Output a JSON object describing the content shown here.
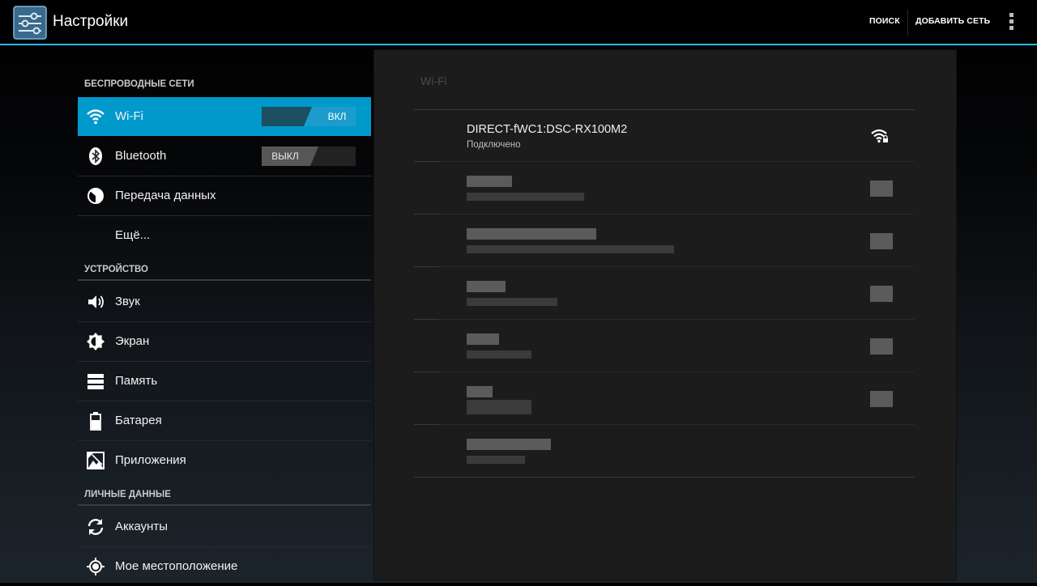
{
  "app": {
    "title": "Настройки",
    "icon": "settings-sliders-icon"
  },
  "actionbar": {
    "search_label": "ПОИСК",
    "add_network_label": "ДОБАВИТЬ СЕТЬ",
    "overflow_icon": "overflow-menu-icon"
  },
  "sections": {
    "wireless": "БЕСПРОВОДНЫЕ СЕТИ",
    "device": "УСТРОЙСТВО",
    "personal": "ЛИЧНЫЕ ДАННЫЕ"
  },
  "items": {
    "wifi": {
      "label": "Wi-Fi",
      "icon": "wifi-icon",
      "toggle": "ВКЛ",
      "state": "on"
    },
    "bluetooth": {
      "label": "Bluetooth",
      "icon": "bluetooth-icon",
      "toggle": "ВЫКЛ",
      "state": "off"
    },
    "data": {
      "label": "Передача данных",
      "icon": "data-usage-icon"
    },
    "more": {
      "label": "Ещё..."
    },
    "sound": {
      "label": "Звук",
      "icon": "speaker-icon"
    },
    "display": {
      "label": "Экран",
      "icon": "brightness-icon"
    },
    "storage": {
      "label": "Память",
      "icon": "storage-icon"
    },
    "battery": {
      "label": "Батарея",
      "icon": "battery-icon"
    },
    "apps": {
      "label": "Приложения",
      "icon": "apps-icon"
    },
    "accounts": {
      "label": "Аккаунты",
      "icon": "sync-icon"
    },
    "location": {
      "label": "Мое местоположение",
      "icon": "location-icon"
    }
  },
  "detail": {
    "title": "Wi-Fi",
    "connected_network": {
      "ssid": "DIRECT-fWC1:DSC-RX100M2",
      "status": "Подключено",
      "icon": "wifi-lock-icon"
    },
    "blurred_networks_count": 6
  },
  "colors": {
    "accent": "#33b5e5",
    "selected_bg": "#0099cc"
  }
}
